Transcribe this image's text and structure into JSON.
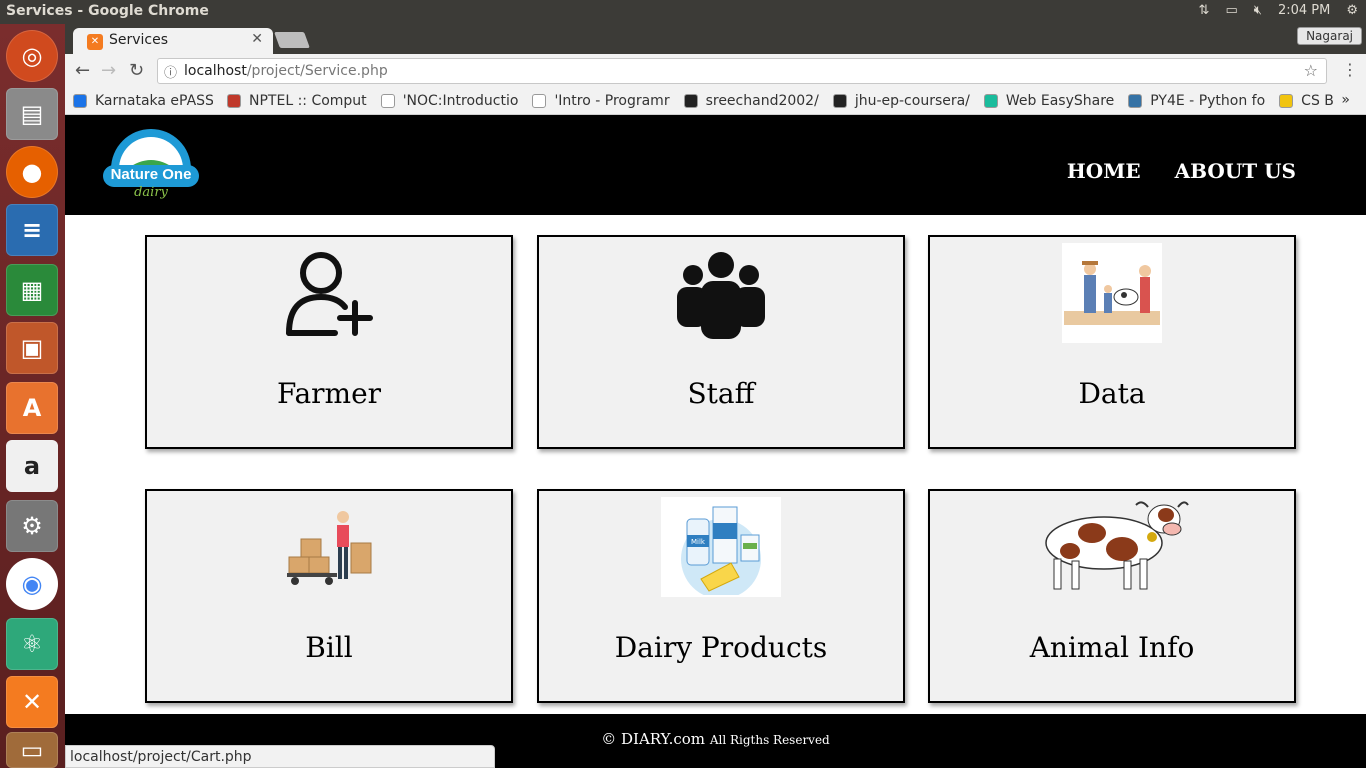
{
  "os": {
    "window_title": "Services - Google Chrome",
    "clock": "2:04 PM",
    "launcher": [
      "ubuntu-icon",
      "files-icon",
      "firefox-icon",
      "writer-icon",
      "calc-icon",
      "impress-icon",
      "software-center-icon",
      "amazon-icon",
      "settings-icon",
      "chrome-icon",
      "atom-icon",
      "xampp-icon",
      "trash-icon"
    ]
  },
  "browser": {
    "tab_title": "Services",
    "profile": "Nagaraj",
    "url_host": "localhost",
    "url_path": "/project/Service.php",
    "bookmarks": [
      {
        "label": "Karnataka ePASS",
        "color": "#1a73e8"
      },
      {
        "label": "NPTEL :: Comput",
        "color": "#c0392b"
      },
      {
        "label": "'NOC:Introductio",
        "color": "#ffffff"
      },
      {
        "label": "'Intro - Programr",
        "color": "#ffffff"
      },
      {
        "label": "sreechand2002/",
        "color": "#222222"
      },
      {
        "label": "jhu-ep-coursera/",
        "color": "#222222"
      },
      {
        "label": "Web EasyShare",
        "color": "#1abc9c"
      },
      {
        "label": "PY4E - Python fo",
        "color": "#3572A5"
      },
      {
        "label": "CS B",
        "color": "#f1c40f"
      }
    ],
    "more": "»",
    "status_url": "localhost/project/Cart.php"
  },
  "site": {
    "logo_text": "Nature One",
    "logo_sub": "dairy",
    "nav": {
      "home": "HOME",
      "about": "ABOUT US"
    },
    "cards": [
      {
        "label": "Farmer",
        "icon": "add-user-icon"
      },
      {
        "label": "Staff",
        "icon": "group-icon"
      },
      {
        "label": "Data",
        "icon": "farmer-family-icon"
      },
      {
        "label": "Bill",
        "icon": "delivery-man-icon"
      },
      {
        "label": "Dairy Products",
        "icon": "dairy-products-icon"
      },
      {
        "label": "Animal Info",
        "icon": "cow-icon"
      }
    ],
    "footer_main": "© DIARY.com",
    "footer_small": "All Rigths Reserved"
  }
}
